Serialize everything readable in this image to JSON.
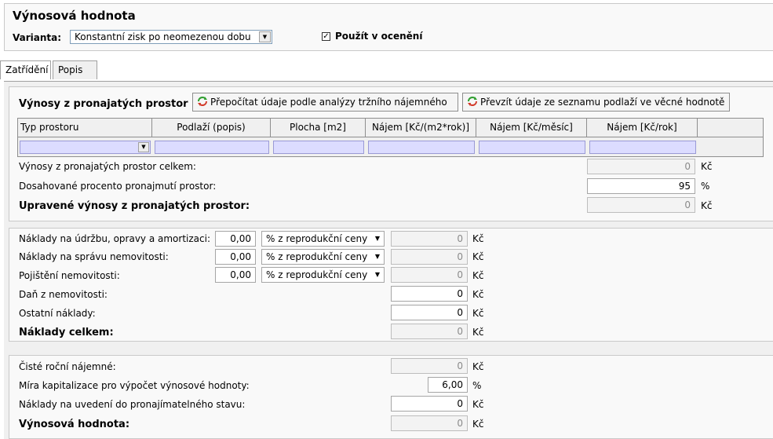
{
  "header": {
    "title": "Výnosová hodnota",
    "variant_label": "Varianta:",
    "variant_value": "Konstantní zisk po neomezenou dobu",
    "use_in_valuation_label": "Použít v ocenění",
    "use_in_valuation_checked": "✓"
  },
  "tabs": [
    {
      "label": "Zatřídění",
      "active": true
    },
    {
      "label": "Popis",
      "active": false
    }
  ],
  "income": {
    "title": "Výnosy z pronajatých prostor",
    "recalc_button": "Přepočítat údaje podle analýzy tržního nájemného",
    "take_button": "Převzít údaje ze seznamu podlaží ve věcné hodnotě",
    "columns": [
      "Typ prostoru",
      "Podlaží (popis)",
      "Plocha [m2]",
      "Nájem [Kč/(m2*rok)]",
      "Nájem [Kč/měsíc]",
      "Nájem [Kč/rok]"
    ],
    "total_label": "Výnosy z pronajatých prostor celkem:",
    "total_value": "0",
    "occupancy_label": "Dosahované procento pronajmutí prostor:",
    "occupancy_value": "95",
    "adjusted_label": "Upravené výnosy z pronajatých prostor:",
    "adjusted_value": "0",
    "unit_czk": "Kč",
    "unit_pct": "%"
  },
  "costs": {
    "rows": [
      {
        "label": "Náklady na údržbu, opravy a amortizaci:",
        "pct": "0,00",
        "basis": "% z reprodukční ceny",
        "value": "0"
      },
      {
        "label": "Náklady na správu nemovitosti:",
        "pct": "0,00",
        "basis": "% z reprodukční ceny",
        "value": "0"
      },
      {
        "label": "Pojištění nemovitosti:",
        "pct": "0,00",
        "basis": "% z reprodukční ceny",
        "value": "0"
      }
    ],
    "tax_label": "Daň z nemovitosti:",
    "tax_value": "0",
    "other_label": "Ostatní náklady:",
    "other_value": "0",
    "total_label": "Náklady celkem:",
    "total_value": "0",
    "unit_czk": "Kč"
  },
  "result": {
    "net_label": "Čisté roční nájemné:",
    "net_value": "0",
    "cap_rate_label": "Míra kapitalizace pro výpočet výnosové hodnoty:",
    "cap_rate_value": "6,00",
    "prep_label": "Náklady na uvedení do pronajímatelného stavu:",
    "prep_value": "0",
    "income_value_label": "Výnosová hodnota:",
    "income_value_value": "0",
    "unit_czk": "Kč",
    "unit_pct": "%"
  },
  "colors": {
    "table_input_fill": "#dcdcff",
    "icon_green": "#2e9e2e",
    "icon_red": "#d23a2a"
  }
}
